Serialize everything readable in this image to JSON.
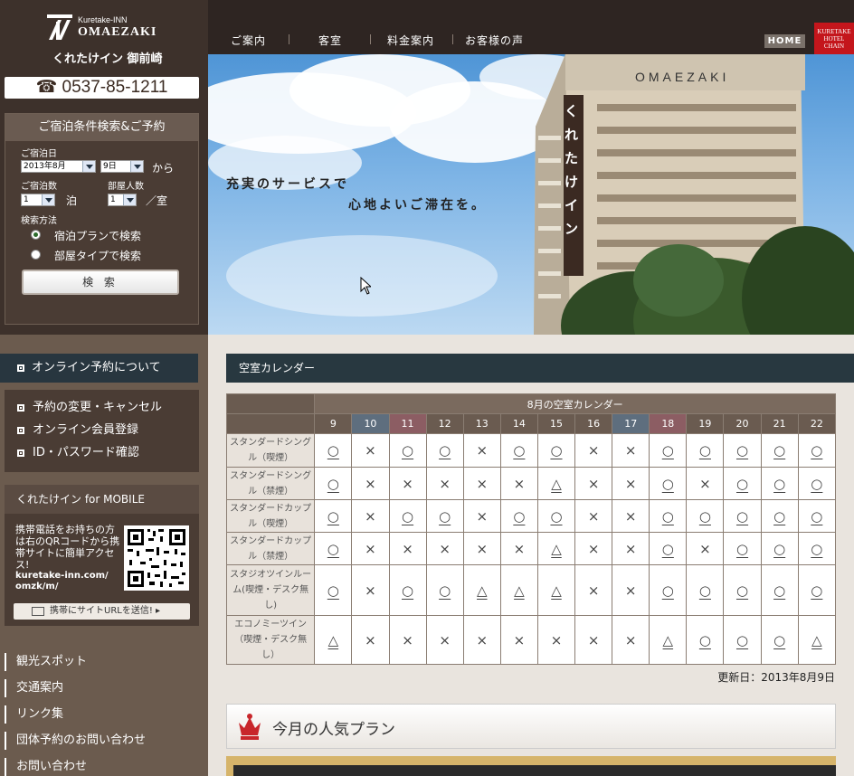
{
  "logo": {
    "en_small": "Kuretake-INN",
    "en_big": "OMAEZAKI",
    "ja": "くれたけイン 御前崎"
  },
  "phone": "☎ 0537-85-1211",
  "search": {
    "title": "ご宿泊条件検索&ご予約",
    "date_label": "ご宿泊日",
    "month_value": "2013年8月",
    "day_value": "9日",
    "from_text": "から",
    "nights_label": "ご宿泊数",
    "nights_value": "1",
    "nights_unit": "泊",
    "rooms_label": "部屋人数",
    "rooms_value": "1",
    "rooms_unit": "／室",
    "method_label": "検索方法",
    "option_plan": "宿泊プランで検索",
    "option_room": "部屋タイプで検索",
    "button": "検 索"
  },
  "sidebar": {
    "online_title": "オンライン予約について",
    "menu": [
      "予約の変更・キャンセル",
      "オンライン会員登録",
      "ID・パスワード確認"
    ],
    "mobile_title": "くれたけイン for MOBILE",
    "mobile_text": "携帯電話をお持ちの方は右のQRコードから携帯サイトに簡単アクセス!",
    "mobile_url_1": "kuretake-inn.com/",
    "mobile_url_2": "omzk/m/",
    "send_button": "携帯にサイトURLを送信! ▸",
    "links": [
      "観光スポット",
      "交通案内",
      "リンク集",
      "団体予約のお問い合わせ",
      "お問い合わせ"
    ]
  },
  "nav": [
    "ご案内",
    "客室",
    "料金案内",
    "お客様の声"
  ],
  "home_button": "HOME",
  "chain_logo": "KURETAKE HOTEL CHAIN",
  "hero": {
    "line1": "充実のサービスで",
    "line2": "心地よいご滞在を。",
    "building_sign": "OMAEZAKI",
    "vertical_sign": "くれたけイン"
  },
  "calendar": {
    "section_title": "空室カレンダー",
    "caption": "8月の空室カレンダー",
    "days": [
      {
        "d": "9",
        "k": "n"
      },
      {
        "d": "10",
        "k": "sat"
      },
      {
        "d": "11",
        "k": "sun"
      },
      {
        "d": "12",
        "k": "n"
      },
      {
        "d": "13",
        "k": "n"
      },
      {
        "d": "14",
        "k": "n"
      },
      {
        "d": "15",
        "k": "n"
      },
      {
        "d": "16",
        "k": "n"
      },
      {
        "d": "17",
        "k": "sat"
      },
      {
        "d": "18",
        "k": "sun"
      },
      {
        "d": "19",
        "k": "n"
      },
      {
        "d": "20",
        "k": "n"
      },
      {
        "d": "21",
        "k": "n"
      },
      {
        "d": "22",
        "k": "n"
      }
    ],
    "rows": [
      {
        "room": "スタンダードシングル（喫煙）",
        "v": [
          "○",
          "×",
          "○",
          "○",
          "×",
          "○",
          "○",
          "×",
          "×",
          "○",
          "○",
          "○",
          "○",
          "○"
        ]
      },
      {
        "room": "スタンダードシングル（禁煙）",
        "v": [
          "○",
          "×",
          "×",
          "×",
          "×",
          "×",
          "△",
          "×",
          "×",
          "○",
          "×",
          "○",
          "○",
          "○"
        ]
      },
      {
        "room": "スタンダードカップル（喫煙）",
        "v": [
          "○",
          "×",
          "○",
          "○",
          "×",
          "○",
          "○",
          "×",
          "×",
          "○",
          "○",
          "○",
          "○",
          "○"
        ]
      },
      {
        "room": "スタンダードカップル（禁煙）",
        "v": [
          "○",
          "×",
          "×",
          "×",
          "×",
          "×",
          "△",
          "×",
          "×",
          "○",
          "×",
          "○",
          "○",
          "○"
        ]
      },
      {
        "room": "スタジオツインルーム(喫煙・デスク無し)",
        "v": [
          "○",
          "×",
          "○",
          "○",
          "△",
          "△",
          "△",
          "×",
          "×",
          "○",
          "○",
          "○",
          "○",
          "○"
        ]
      },
      {
        "room": "エコノミーツイン（喫煙・デスク無し）",
        "v": [
          "△",
          "×",
          "×",
          "×",
          "×",
          "×",
          "×",
          "×",
          "×",
          "△",
          "○",
          "○",
          "○",
          "△"
        ]
      }
    ],
    "updated": "更新日：2013年8月9日"
  },
  "popular_plan_title": "今月の人気プラン"
}
